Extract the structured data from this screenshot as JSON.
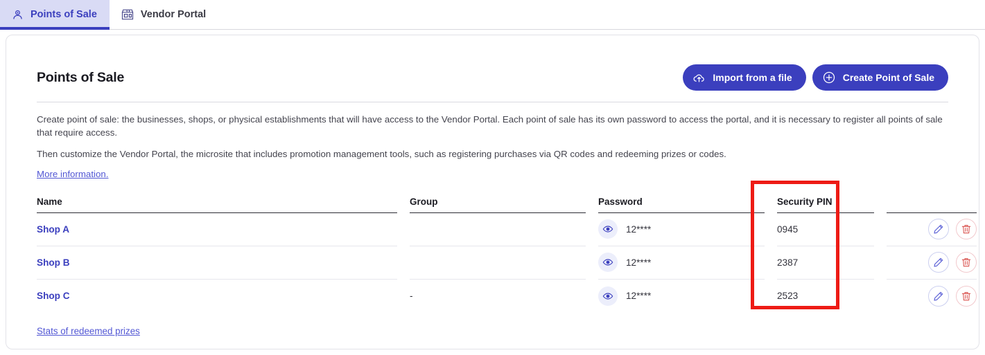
{
  "tabs": [
    {
      "label": "Points of Sale",
      "icon": "user-location-icon",
      "active": true
    },
    {
      "label": "Vendor Portal",
      "icon": "storefront-icon",
      "active": false
    }
  ],
  "header": {
    "title": "Points of Sale",
    "import_button": "Import from a file",
    "import_icon": "upload-cloud-icon",
    "create_button": "Create Point of Sale",
    "create_icon": "plus-circle-icon"
  },
  "intro": {
    "paragraph1": "Create point of sale: the businesses, shops, or physical establishments that will have access to the Vendor Portal. Each point of sale has its own password to access the portal, and it is necessary to register all points of sale that require access.",
    "paragraph2": "Then customize the Vendor Portal, the microsite that includes promotion management tools, such as registering purchases via QR codes and redeeming prizes or codes.",
    "more_info_link": "More information."
  },
  "table": {
    "columns": [
      "Name",
      "Group",
      "Password",
      "Security PIN"
    ],
    "rows": [
      {
        "name": "Shop A",
        "group": "",
        "password": "12****",
        "pin": "0945"
      },
      {
        "name": "Shop B",
        "group": "",
        "password": "12****",
        "pin": "2387"
      },
      {
        "name": "Shop C",
        "group": "-",
        "password": "12****",
        "pin": "2523"
      }
    ],
    "row_icons": {
      "reveal": "eye-icon",
      "edit": "pencil-icon",
      "delete": "trash-icon"
    }
  },
  "footer": {
    "stats_link": "Stats of redeemed prizes"
  },
  "annotation": {
    "highlight_column": "Security PIN",
    "color": "#ee1b15"
  },
  "colors": {
    "brand": "#3b3fbe",
    "tab_active_bg": "#d9dbf5",
    "link": "#5257d4",
    "danger": "#d9534f",
    "annotation": "#ee1b15"
  }
}
